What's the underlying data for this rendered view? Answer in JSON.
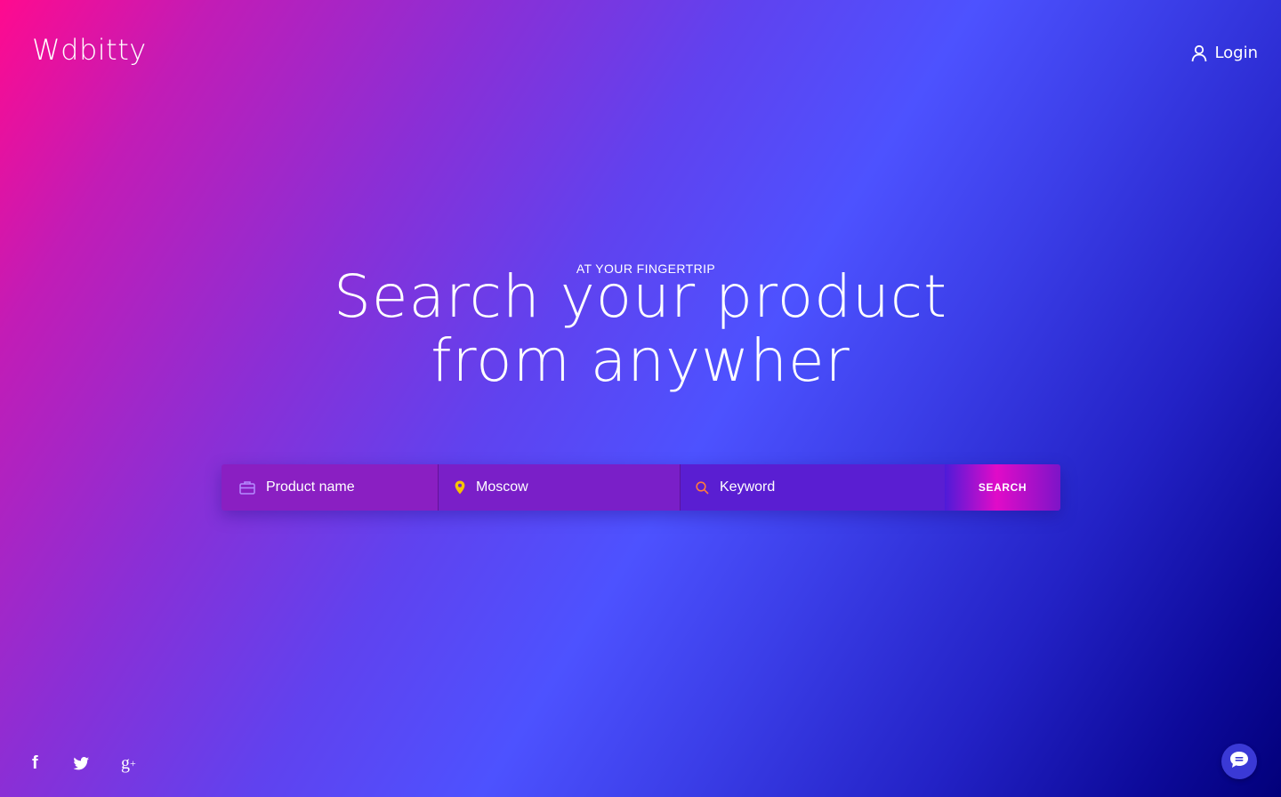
{
  "header": {
    "logo_text": "Wdbitty",
    "login_label": "Login"
  },
  "hero": {
    "eyebrow": "AT YOUR FINGERTRIP",
    "headline_line1": "Search your product",
    "headline_line2": "from anywher"
  },
  "search": {
    "product_placeholder": "Product name",
    "location_value": "Moscow",
    "keyword_placeholder": "Keyword",
    "button_label": "SEARCH",
    "icons": [
      "briefcase-icon",
      "location-pin-icon",
      "search-icon"
    ]
  },
  "social": {
    "items": [
      "facebook-icon",
      "twitter-icon",
      "google-plus-icon"
    ]
  },
  "chat": {
    "icon": "chat-bubble-icon"
  },
  "colors": {
    "gradient_start": "#ff0a8f",
    "gradient_mid": "#4d52ff",
    "gradient_end": "#02007a",
    "pin_color": "#f5c400",
    "search_icon_color": "#ff7a3d",
    "briefcase_icon_color": "#b58cff"
  }
}
